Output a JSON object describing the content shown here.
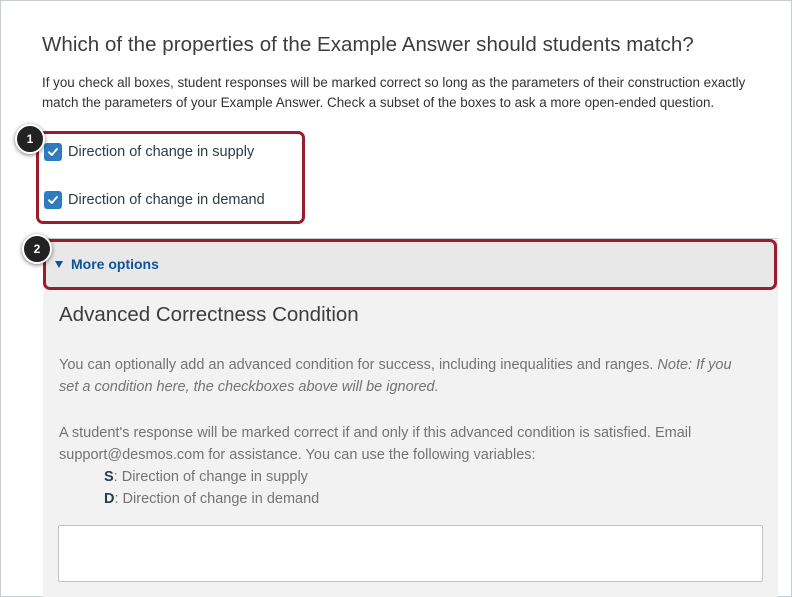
{
  "question": {
    "title": "Which of the properties of the Example Answer should students match?",
    "description": "If you check all boxes, student responses will be marked correct so long as the parameters of their construction exactly match the parameters of your Example Answer. Check a subset of the boxes to ask a more open-ended question."
  },
  "checkboxes": [
    {
      "label": "Direction of change in supply",
      "checked": true
    },
    {
      "label": "Direction of change in demand",
      "checked": true
    }
  ],
  "callouts": {
    "one": "1",
    "two": "2",
    "color": "#9b1c2b"
  },
  "more_options": {
    "label": "More options",
    "icon": "triangle-down-icon"
  },
  "advanced": {
    "title": "Advanced Correctness Condition",
    "intro": "You can optionally add an advanced condition for success, including inequalities and ranges.",
    "note": "Note: If you set a condition here, the checkboxes above will be ignored.",
    "info": "A student's response will be marked correct if and only if this advanced condition is satisfied. Email support@desmos.com for assistance. You can use the following variables:",
    "variables": [
      {
        "key": "S",
        "desc": ": Direction of change in supply"
      },
      {
        "key": "D",
        "desc": ": Direction of change in demand"
      }
    ],
    "input_value": ""
  },
  "colors": {
    "accent": "#2d7bc0",
    "link": "#0d5597",
    "panel": "#f2f2f2"
  }
}
